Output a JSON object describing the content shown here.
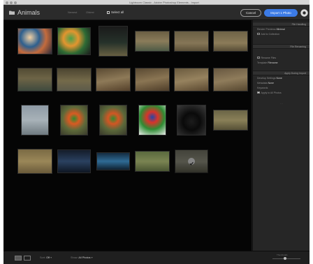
{
  "window": {
    "title": "Lightroom Classic - Adobe Photoshop Elements - Import"
  },
  "header": {
    "folder_title": "Animals",
    "sort_options": [
      "Newest",
      "Oldest"
    ],
    "select_all_label": "Select all",
    "cancel_label": "Cancel",
    "import_label": "Import 1 Photo"
  },
  "grid": {
    "photos": [
      {
        "subject": "coral-fish",
        "selected": false
      },
      {
        "subject": "sea-anemone",
        "selected": false
      },
      {
        "subject": "stilt-bird",
        "selected": false
      },
      {
        "subject": "egret-water",
        "selected": false
      },
      {
        "subject": "heron-flight",
        "selected": false
      },
      {
        "subject": "egret-flight",
        "selected": false
      },
      {
        "subject": "shorebird",
        "selected": false
      },
      {
        "subject": "egret-rocks",
        "selected": false
      },
      {
        "subject": "rocky-shore",
        "selected": false
      },
      {
        "subject": "rocky-shore-2",
        "selected": false
      },
      {
        "subject": "egret-walk",
        "selected": false
      },
      {
        "subject": "egret-perch",
        "selected": false
      },
      {
        "subject": "white-heron",
        "selected": false
      },
      {
        "subject": "lorikeet-1",
        "selected": false
      },
      {
        "subject": "lorikeet-2",
        "selected": false
      },
      {
        "subject": "lorikeet-3",
        "selected": false
      },
      {
        "subject": "black-cat",
        "selected": false
      },
      {
        "subject": "lizard",
        "selected": false
      },
      {
        "subject": "sand-tracks",
        "selected": false
      },
      {
        "subject": "shark-1",
        "selected": false
      },
      {
        "subject": "shark-2",
        "selected": false
      },
      {
        "subject": "crocodile",
        "selected": false
      },
      {
        "subject": "lizard-2",
        "selected": true
      }
    ]
  },
  "panel": {
    "file_handling": {
      "header": "File Handling",
      "rows": [
        {
          "label": "Render Previews",
          "value": "Minimal"
        },
        {
          "label": "Add to Collection",
          "checked": false
        }
      ]
    },
    "file_renaming": {
      "header": "File Renaming",
      "rows": [
        {
          "label": "Rename Files",
          "checked": false
        },
        {
          "label": "Template",
          "value": "Filename"
        }
      ]
    },
    "apply_during_import": {
      "header": "Apply During Import",
      "rows": [
        {
          "label": "Develop Settings",
          "value": "None"
        },
        {
          "label": "Metadata",
          "value": "None"
        },
        {
          "label": "Keywords",
          "value": ""
        },
        {
          "label": "Apply to All Photos",
          "checked": true
        }
      ]
    },
    "handle_glyph": "⋯"
  },
  "footer": {
    "sort_label": "Sort:",
    "sort_value": "Off",
    "show_label": "Show:",
    "show_value": "All Photos",
    "thumbnails_label": "Thumbnails",
    "thumb_level": 0.45
  },
  "colors": {
    "accent": "#3c7be6",
    "panel": "#262626",
    "grid": "#050505"
  }
}
